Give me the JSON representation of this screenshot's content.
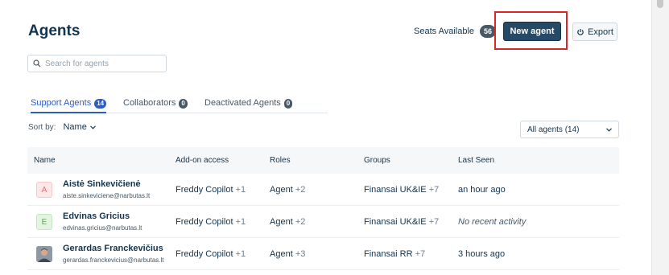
{
  "header": {
    "title": "Agents",
    "seats_label": "Seats Available",
    "seats_count": "56",
    "new_agent_label": "New agent",
    "export_label": "Export"
  },
  "search": {
    "placeholder": "Search for agents"
  },
  "tabs": [
    {
      "label": "Support Agents",
      "count": "14",
      "active": true
    },
    {
      "label": "Collaborators",
      "count": "0",
      "active": false
    },
    {
      "label": "Deactivated Agents",
      "count": "0",
      "active": false
    }
  ],
  "sort": {
    "label": "Sort by:",
    "value": "Name"
  },
  "filter": {
    "value": "All agents (14)"
  },
  "table": {
    "columns": [
      "Name",
      "Add-on access",
      "Roles",
      "Groups",
      "Last Seen"
    ],
    "rows": [
      {
        "initial": "A",
        "name": "Aistė Sinkevičienė",
        "email": "aiste.sinkeviciene@narbutas.lt",
        "addon": "Freddy Copilot",
        "addon_more": "+1",
        "role": "Agent",
        "role_more": "+2",
        "group": "Finansai UK&IE",
        "group_more": "+7",
        "last_seen": "an hour ago"
      },
      {
        "initial": "E",
        "name": "Edvinas Gricius",
        "email": "edvinas.gricius@narbutas.lt",
        "addon": "Freddy Copilot",
        "addon_more": "+1",
        "role": "Agent",
        "role_more": "+2",
        "group": "Finansai UK&IE",
        "group_more": "+7",
        "last_seen": "No recent activity"
      },
      {
        "initial": "",
        "name": "Gerardas Franckevičius",
        "email": "gerardas.franckevicius@narbutas.lt",
        "addon": "Freddy Copilot",
        "addon_more": "+1",
        "role": "Agent",
        "role_more": "+3",
        "group": "Finansai RR",
        "group_more": "+7",
        "last_seen": "3 hours ago"
      }
    ]
  },
  "colors": {
    "primary": "#264966",
    "accent_blue": "#2c5cc5",
    "highlight_red": "#d9262a",
    "avatar_pink": "#fde7e7",
    "avatar_green": "#e3f4e0"
  }
}
